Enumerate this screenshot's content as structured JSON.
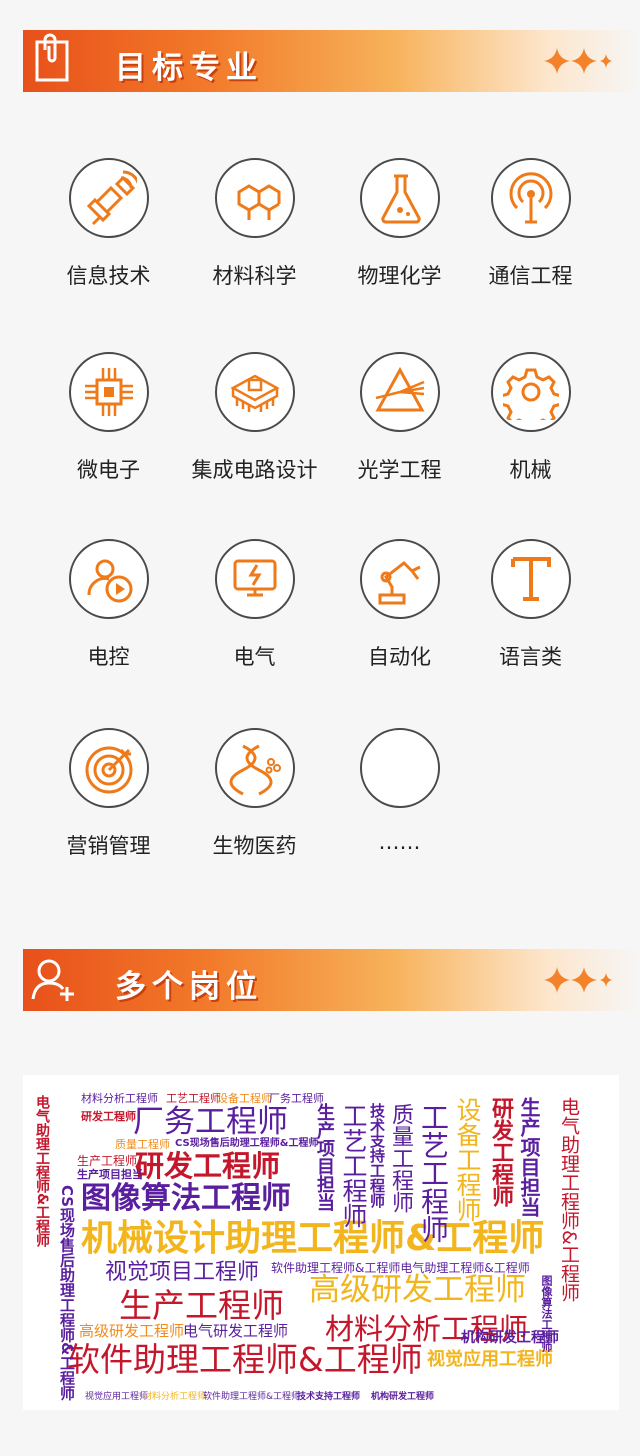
{
  "section1": {
    "title": "目标专业"
  },
  "majors": [
    {
      "label": "信息技术",
      "icon": "satellite-icon"
    },
    {
      "label": "材料科学",
      "icon": "molecule-icon"
    },
    {
      "label": "物理化学",
      "icon": "flask-icon"
    },
    {
      "label": "通信工程",
      "icon": "signal-tower-icon"
    },
    {
      "label": "微电子",
      "icon": "chip-icon"
    },
    {
      "label": "集成电路设计",
      "icon": "ic-package-icon"
    },
    {
      "label": "光学工程",
      "icon": "prism-icon"
    },
    {
      "label": "机械",
      "icon": "gear-icon"
    },
    {
      "label": "电控",
      "icon": "control-play-icon"
    },
    {
      "label": "电气",
      "icon": "electric-screen-icon"
    },
    {
      "label": "自动化",
      "icon": "robot-arm-icon"
    },
    {
      "label": "语言类",
      "icon": "letter-t-icon"
    },
    {
      "label": "营销管理",
      "icon": "target-icon"
    },
    {
      "label": "生物医药",
      "icon": "dna-icon"
    },
    {
      "label": "……",
      "icon": "empty-icon"
    }
  ],
  "section2": {
    "title": "多个岗位"
  },
  "colors": {
    "accent": "#ef7a1a",
    "banner_start": "#e8501a",
    "purple": "#5a1f9e",
    "red": "#c4172c",
    "orange": "#f08c1c",
    "yellow": "#f2b51d"
  },
  "wordcloud": {
    "words": [
      "材料分析工程师",
      "工艺工程师",
      "设备工程师",
      "厂务工程师",
      "研发工程师",
      "厂务工程师",
      "研发工程师",
      "图像算法工程师",
      "机械设计助理工程师&工程师",
      "视觉项目工程师",
      "生产工程师",
      "高级研发工程师",
      "材料分析工程师",
      "软件助理工程师&工程师",
      "视觉应用工程师",
      "机构研发工程师",
      "CS现场售后助理工程师&工程师",
      "工艺工程师",
      "质量工程师",
      "工艺工程师",
      "设备工程师",
      "研发工程师",
      "生产项目担当",
      "电气助理工程师&工程师",
      "生产项目担当",
      "技术支持工程师",
      "电气研发工程师",
      "质量工程师",
      "高级研发工程师",
      "软件助理工程师&工程师电气助理工程师&工程师",
      "图像算法工程师",
      "机构研发工程师",
      "技术支持工程师",
      "电气研发工程师",
      "视觉应用工程师",
      "材料分析工程师",
      "生产工程师"
    ]
  }
}
